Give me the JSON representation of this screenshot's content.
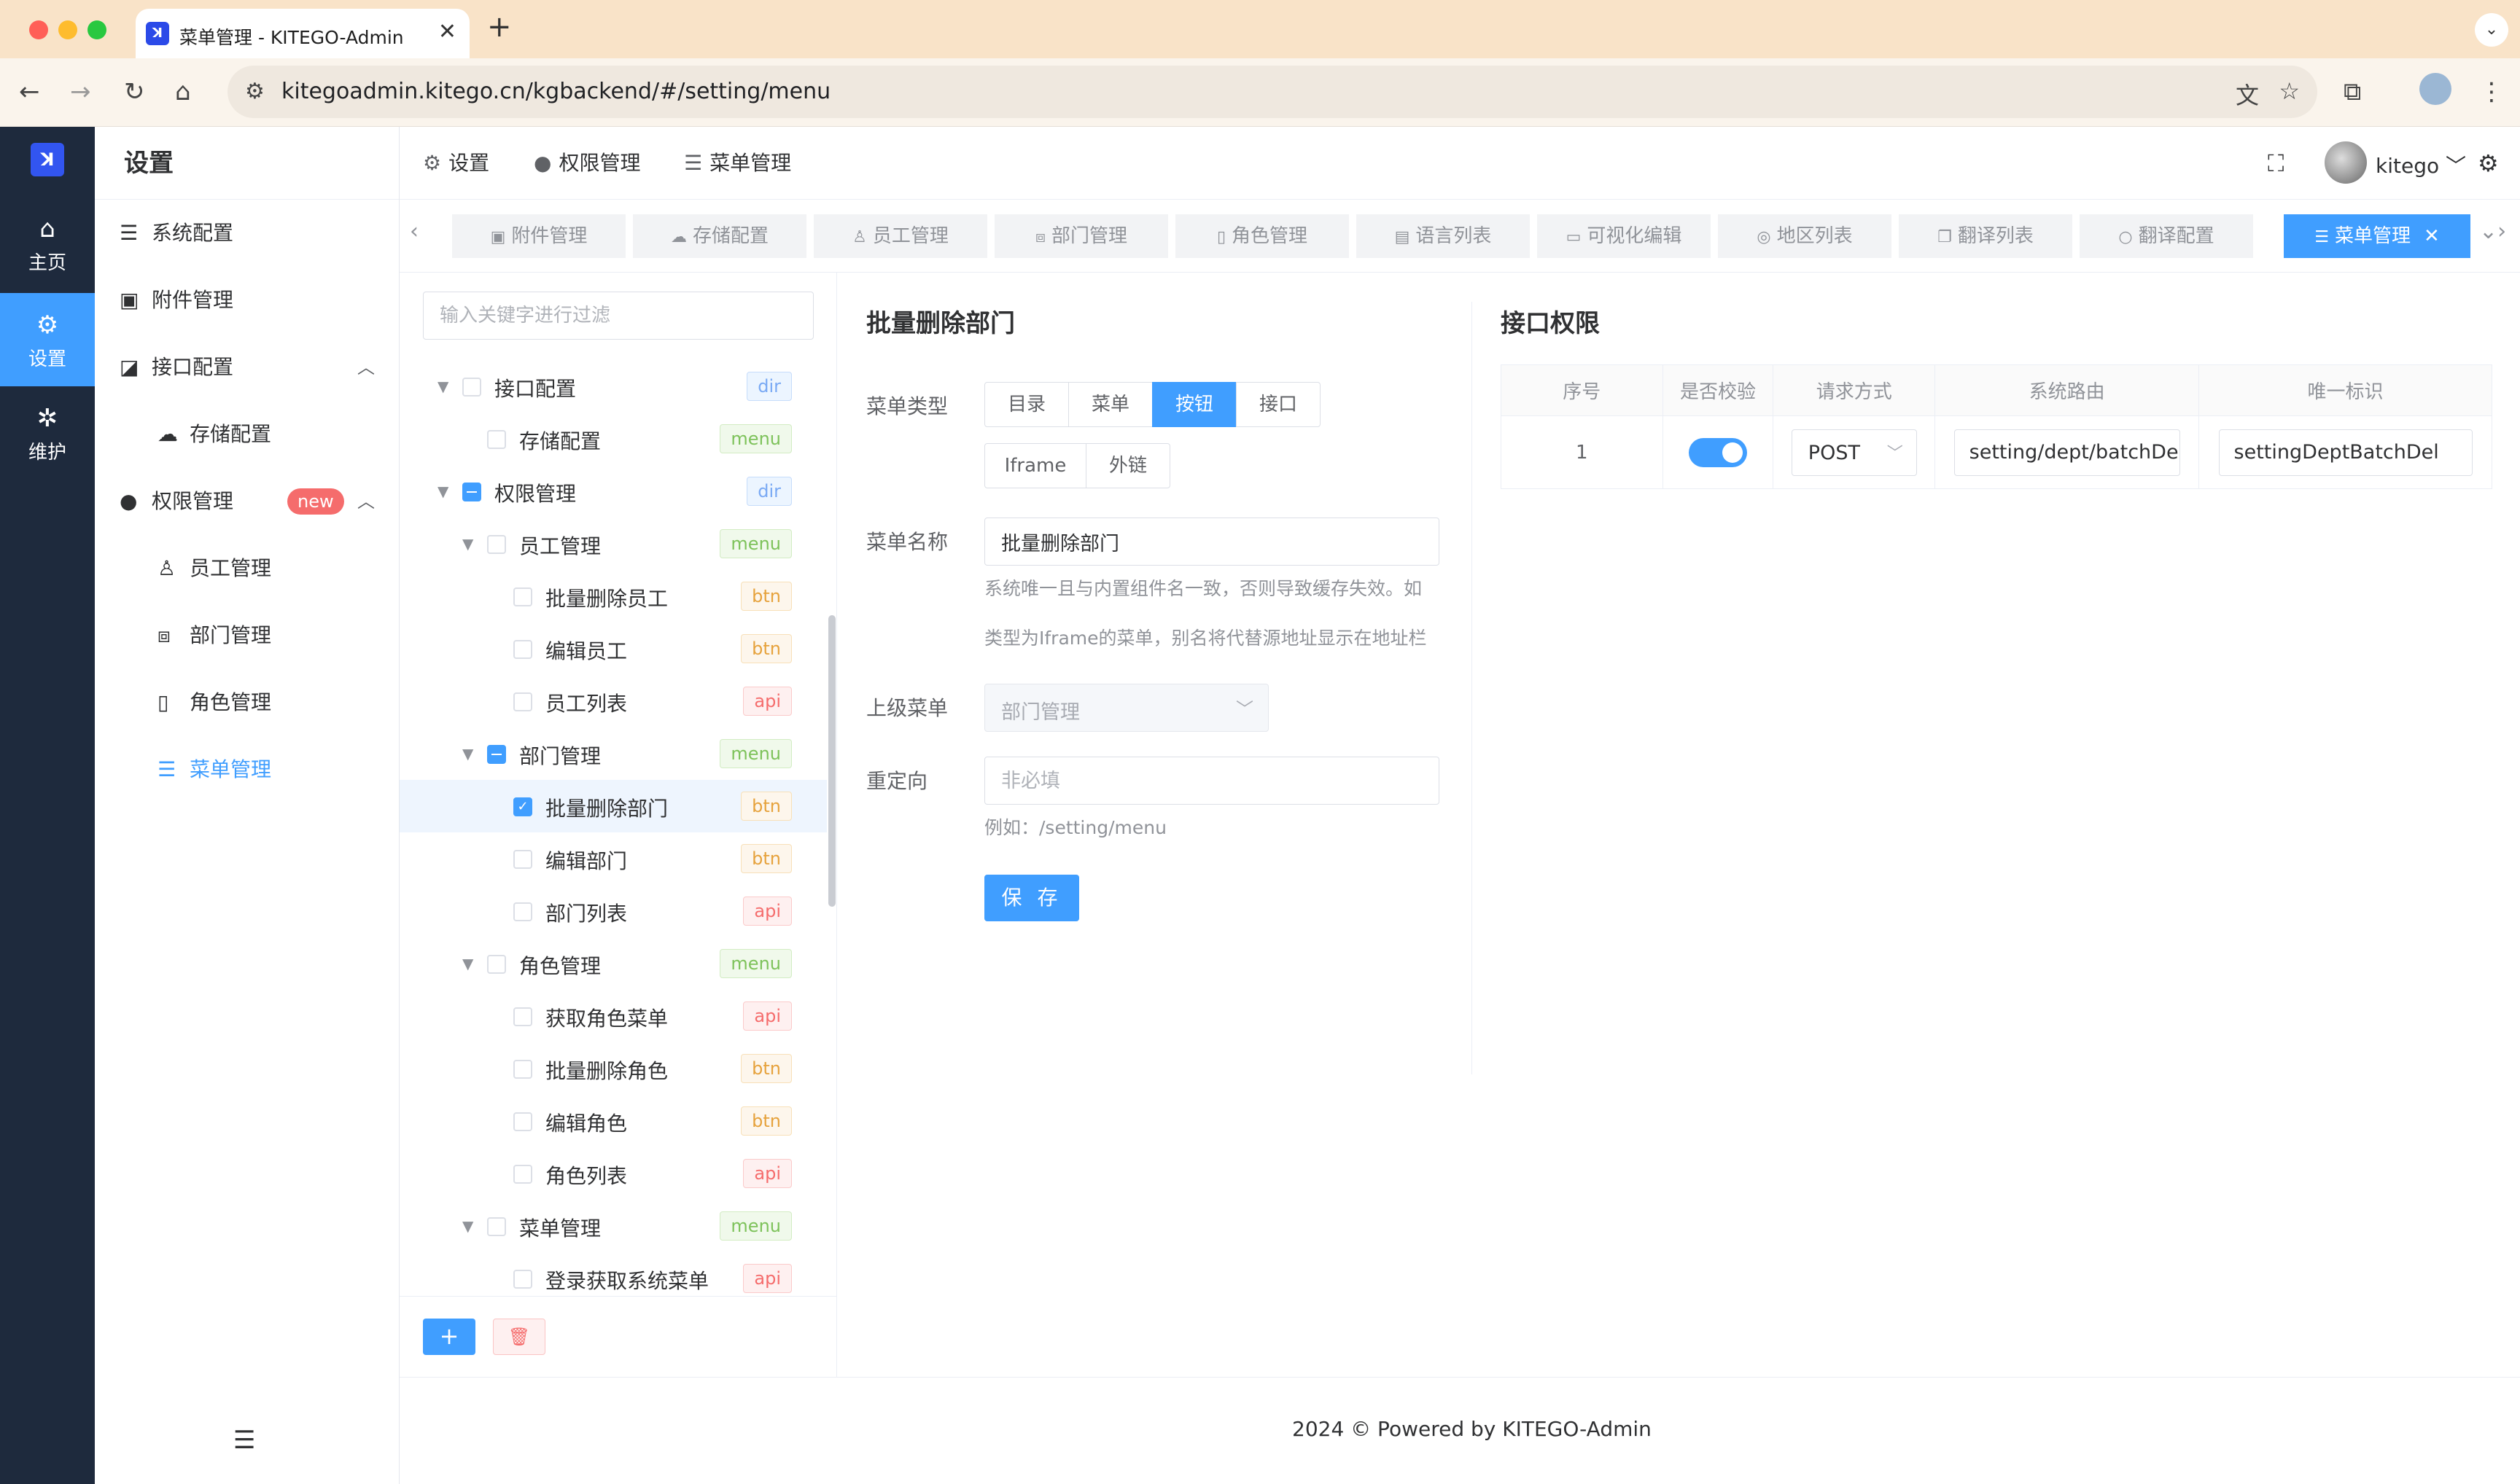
{
  "browser": {
    "tab_title": "菜单管理 - KITEGO-Admin",
    "tab_favicon": "ꓘ",
    "url": "kitegoadmin.kitego.cn/kgbackend/#/setting/menu"
  },
  "rail": {
    "items": [
      {
        "label": "主页",
        "icon": "home-icon"
      },
      {
        "label": "设置",
        "icon": "gear-icon"
      },
      {
        "label": "维护",
        "icon": "bug-icon"
      }
    ]
  },
  "submenu": {
    "title": "设置",
    "items": [
      {
        "label": "系统配置",
        "icon": "sliders-icon"
      },
      {
        "label": "附件管理",
        "icon": "image-icon"
      },
      {
        "label": "接口配置",
        "icon": "chart-icon"
      },
      {
        "label": "存储配置",
        "icon": "cloud-icon"
      },
      {
        "label": "权限管理",
        "icon": "user-icon",
        "badge": "new"
      },
      {
        "label": "员工管理",
        "icon": "person-icon"
      },
      {
        "label": "部门管理",
        "icon": "org-icon"
      },
      {
        "label": "角色管理",
        "icon": "book-icon"
      },
      {
        "label": "菜单管理",
        "icon": "list-icon"
      }
    ]
  },
  "topbar": {
    "breadcrumbs": [
      "设置",
      "权限管理",
      "菜单管理"
    ],
    "username": "kitego"
  },
  "tags": [
    {
      "label": "附件管理"
    },
    {
      "label": "存储配置"
    },
    {
      "label": "员工管理"
    },
    {
      "label": "部门管理"
    },
    {
      "label": "角色管理"
    },
    {
      "label": "语言列表"
    },
    {
      "label": "可视化编辑"
    },
    {
      "label": "地区列表"
    },
    {
      "label": "翻译列表"
    },
    {
      "label": "翻译配置"
    },
    {
      "label": "菜单管理"
    }
  ],
  "tree": {
    "filter_placeholder": "输入关键字进行过滤",
    "nodes": [
      {
        "label": "接口配置",
        "tag": "dir"
      },
      {
        "label": "存储配置",
        "tag": "menu"
      },
      {
        "label": "权限管理",
        "tag": "dir"
      },
      {
        "label": "员工管理",
        "tag": "menu"
      },
      {
        "label": "批量删除员工",
        "tag": "btn"
      },
      {
        "label": "编辑员工",
        "tag": "btn"
      },
      {
        "label": "员工列表",
        "tag": "api"
      },
      {
        "label": "部门管理",
        "tag": "menu"
      },
      {
        "label": "批量删除部门",
        "tag": "btn"
      },
      {
        "label": "编辑部门",
        "tag": "btn"
      },
      {
        "label": "部门列表",
        "tag": "api"
      },
      {
        "label": "角色管理",
        "tag": "menu"
      },
      {
        "label": "获取角色菜单",
        "tag": "api"
      },
      {
        "label": "批量删除角色",
        "tag": "btn"
      },
      {
        "label": "编辑角色",
        "tag": "btn"
      },
      {
        "label": "角色列表",
        "tag": "api"
      },
      {
        "label": "菜单管理",
        "tag": "menu"
      },
      {
        "label": "登录获取系统菜单",
        "tag": "api"
      }
    ]
  },
  "form": {
    "title": "批量删除部门",
    "type_label": "菜单类型",
    "types": [
      "目录",
      "菜单",
      "按钮",
      "接口",
      "Iframe",
      "外链"
    ],
    "name_label": "菜单名称",
    "name_value": "批量删除部门",
    "name_help_1": "系统唯一且与内置组件名一致，否则导致缓存失效。如",
    "name_help_2": "类型为Iframe的菜单，别名将代替源地址显示在地址栏",
    "parent_label": "上级菜单",
    "parent_value": "部门管理",
    "redirect_label": "重定向",
    "redirect_placeholder": "非必填",
    "redirect_help": "例如：/setting/menu",
    "save_label": "保 存"
  },
  "api": {
    "title": "接口权限",
    "headers": [
      "序号",
      "是否校验",
      "请求方式",
      "系统路由",
      "唯一标识"
    ],
    "row": {
      "index": "1",
      "method": "POST",
      "route": "setting/dept/batchDel",
      "key": "settingDeptBatchDel"
    }
  },
  "footer": {
    "text": "2024 © Powered by  KITEGO-Admin"
  },
  "colors": {
    "primary": "#409eff",
    "rail": "#1e2a3d",
    "danger": "#f56c6c"
  }
}
